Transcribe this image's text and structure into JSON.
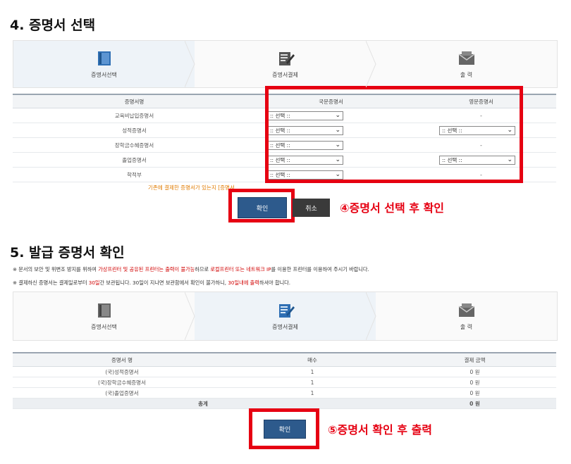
{
  "section4": {
    "title": "4. 증명서 선택",
    "steps": [
      "증명서선택",
      "증명서결제",
      "출 력"
    ],
    "table": {
      "headers": [
        "증명서명",
        "국문증명서",
        "영문증명서"
      ],
      "rows": [
        {
          "name": "교육비납입증명서",
          "kor": ":: 선택 ::",
          "eng": "-"
        },
        {
          "name": "성적증명서",
          "kor": ":: 선택 ::",
          "eng": ":: 선택 ::"
        },
        {
          "name": "장학금수혜증명서",
          "kor": ":: 선택 ::",
          "eng": "-"
        },
        {
          "name": "졸업증명서",
          "kor": ":: 선택 ::",
          "eng": ":: 선택 ::"
        },
        {
          "name": "학적부",
          "kor": ":: 선택 ::",
          "eng": "-"
        }
      ],
      "note": "기존에 결제한 증명서가 있는지 [증명서"
    },
    "confirm_label": "확인",
    "cancel_label": "취소",
    "annotation": "④증명서 선택 후 확인"
  },
  "section5": {
    "title": "5. 발급 증명서 확인",
    "notice1": {
      "a": "※ 문서의 보안 및 위변조 방지를 위하여 ",
      "b": "가상프린터 및 공유된 프린터는 출력이 불가능",
      "c": "하므로 ",
      "d": "로컬프린터 또는 네트워크 IP",
      "e": "를 이용한 프린터를 이용하여 주시기 바랍니다."
    },
    "notice2": {
      "a": "※ 결제하신 증명서는 결제일로부터 ",
      "b": "30일",
      "c": "간 보관됩니다. 30일이 지나면 보관함에서 확인이 불가하니, ",
      "d": "30일내에 출력",
      "e": "하셔야 합니다."
    },
    "steps": [
      "증명서선택",
      "증명서결제",
      "출 력"
    ],
    "table": {
      "headers": [
        "증명서 명",
        "매수",
        "결제 금액"
      ],
      "rows": [
        {
          "name": "(국)성적증명서",
          "count": "1",
          "amount": "0 원"
        },
        {
          "name": "(국)장학금수혜증명서",
          "count": "1",
          "amount": "0 원"
        },
        {
          "name": "(국)졸업증명서",
          "count": "1",
          "amount": "0 원"
        }
      ],
      "total_label": "총계",
      "total_amount": "0 원"
    },
    "confirm_label": "확인",
    "annotation": "⑤증명서 확인 후 출력"
  },
  "colors": {
    "accent_red": "#e60012",
    "button_blue": "#2d5a8c",
    "button_dark": "#3a3a3a"
  },
  "icons": [
    "document-icon",
    "edit-document-icon",
    "envelope-icon"
  ]
}
